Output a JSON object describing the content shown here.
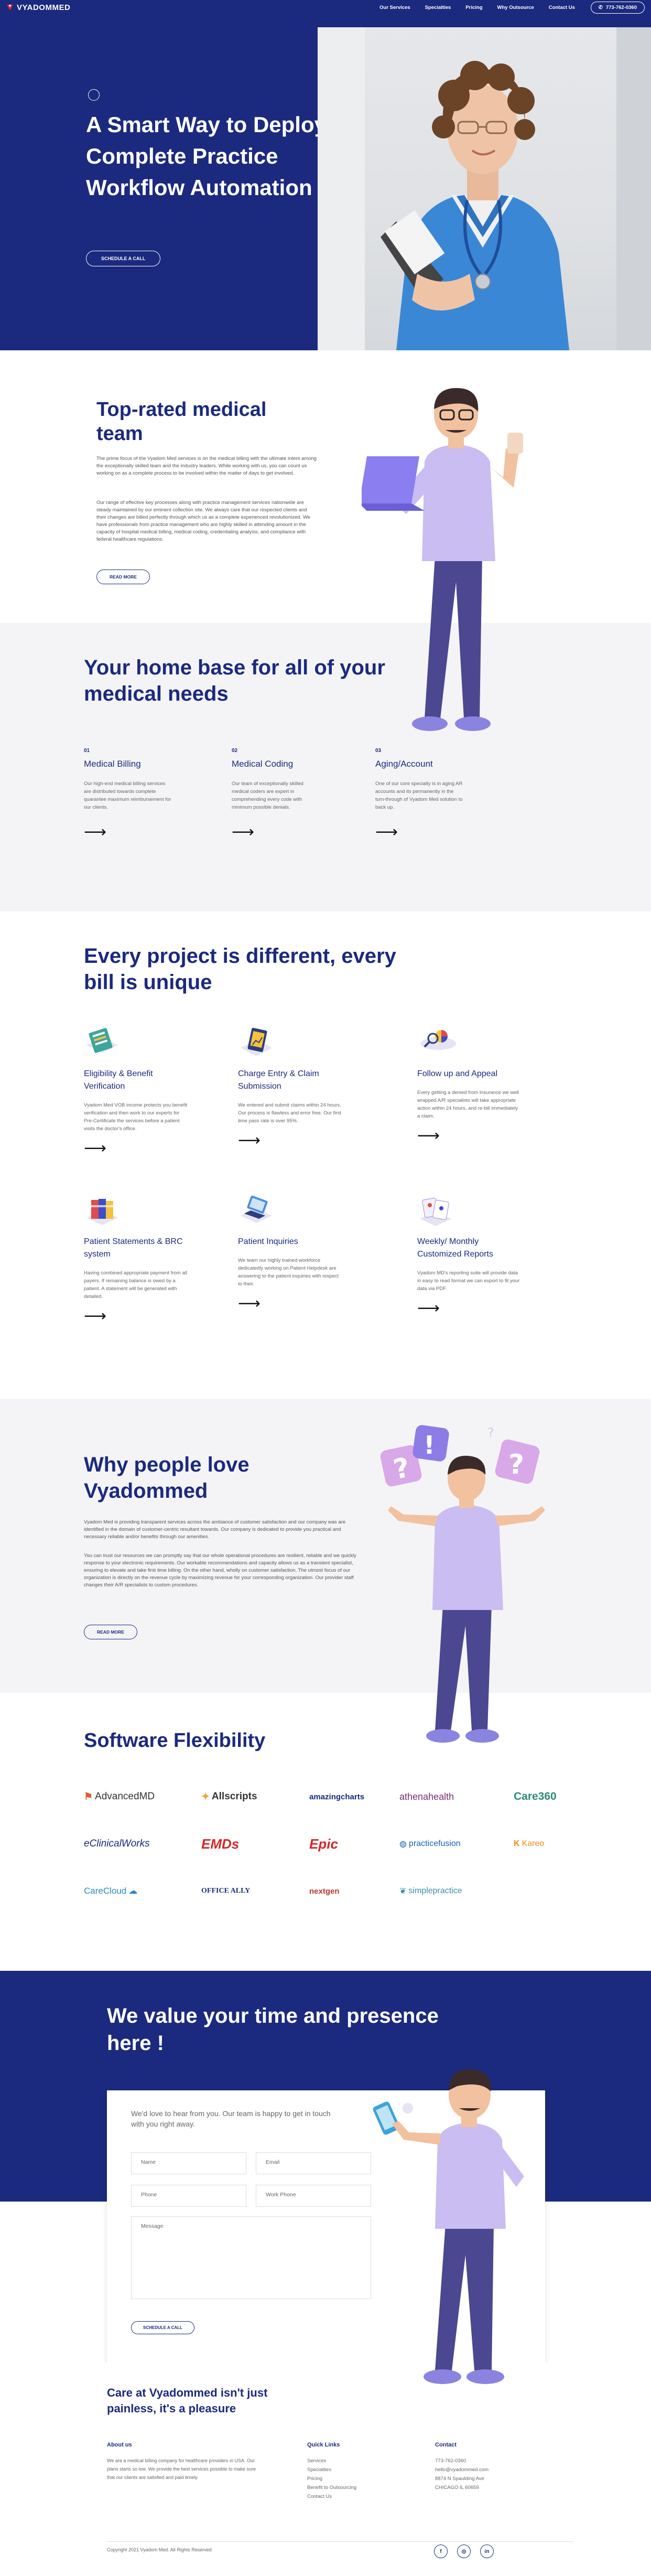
{
  "header": {
    "brand": "VYADOMMED",
    "nav": [
      "Our Services",
      "Specialties",
      "Pricing",
      "Why Outsource",
      "Contact Us"
    ],
    "phone": "773-762-0360"
  },
  "hero": {
    "title": "A Smart Way to Deploy Complete Practice Workflow Automation",
    "button": "SCHEDULE A CALL"
  },
  "top_rated": {
    "title": "Top-rated medical team",
    "p1": "The prime focus of the Vyadom Med services is on the medical billing with the ultimate intent among the exceptionally skilled team and the industry leaders. While working with us, you can count us working on as a complete process to be involved within the matter of days to get involved.",
    "p2": "Our range of effective key processes along with practice management services nationwide are steady maintained by our eminent collection site. We always care that our respected clients and their changes are billed perfectly through which us as a complete experienced revolutionized. We have professionals from practice management who are highly skilled in attending amount in the capacity of hospital medical billing, medical coding, credentialing analysis, and compliance with federal healthcare regulations.",
    "button": "READ MORE"
  },
  "home_base": {
    "title": "Your home base for all of your medical needs",
    "items": [
      {
        "num": "01",
        "title": "Medical Billing",
        "text": "Our high-end medical billing services are distributed towards complete quarantee maximum reimbursement for our clients."
      },
      {
        "num": "02",
        "title": "Medical Coding",
        "text": "Our team of exceptionally skilled medical coders are expert in comprehending every code with minimum possible denials."
      },
      {
        "num": "03",
        "title": "Aging/Account",
        "text": "One of our core specialty is in aging AR accounts and its permanently in the turn-through of Vyadom Med solution to back up."
      }
    ]
  },
  "projects": {
    "title": "Every project is different, every bill is unique",
    "items": [
      {
        "title": "Eligibility & Benefit Verification",
        "text": "Vyadom Med VOB income protects you benefit verification and then work to our experts for Pre-Certificate the services before a patient visits the doctor's office."
      },
      {
        "title": "Charge Entry & Claim Submission",
        "text": "We entered and submit claims within 24 hours. Our process is flawless and error free. Our first time pass rate is over 95%."
      },
      {
        "title": "Follow up and Appeal",
        "text": "Every getting a denied from insurance we well wrapped A/R specialists will take appropriate action within 24 hours, and re-bill immediately a claim."
      },
      {
        "title": "Patient Statements & BRC system",
        "text": "Having combined appropriate payment from all payers. If remaining balance is owed by a patient. A statement will be generated with detailed."
      },
      {
        "title": "Patient Inquiries",
        "text": "We team our highly trained workforce dedicatedly working on Patient Helpdesk are answering to the patient inquiries with respect to their."
      },
      {
        "title": "Weekly/ Monthly Customized Reports",
        "text": "Vyadom MD's reporting suite will provide data in easy to read format we can export to fit your data via PDF."
      }
    ]
  },
  "why": {
    "title": "Why people love Vyadommed",
    "p1": "Vyadom Med is providing transparent services across the ambiance of customer satisfaction and our company was are identified in the domain of customer-centric resultant towards. Our company is dedicated to provide you practical and necessary reliable and/or benefits through our amenities.",
    "p2": "You can trust our resources we can promptly say that our whole operational procedures are resilient, reliable and we quickly response to your electronic requirements. Our workable recommendations and capacity allows us as a transient specialist, ensuring to elevate and take first time billing. On the other hand, wholly on customer satisfaction. The utmost focus of our organization is directly on the revenue cycle by maximizing revenue for your corresponding organization. Our provider staff changes their A/R specialists to custom procedures.",
    "button": "READ MORE"
  },
  "software": {
    "title": "Software Flexibility",
    "logos": [
      "AdvancedMD",
      "Allscripts",
      "amazingcharts",
      "athenahealth",
      "Care360",
      "eClinicalWorks",
      "EMDs",
      "Epic",
      "practicefusion",
      "Kareo",
      "CareCloud",
      "OFFICE ALLY",
      "nextgen",
      "simplepractice"
    ]
  },
  "contact": {
    "title": "We value your time and presence here !",
    "intro": "We'd love to hear from you. Our team is happy to get in touch with you right away.",
    "name_ph": "Name",
    "email_ph": "Email",
    "phone_ph": "Phone",
    "workphone_ph": "Work Phone",
    "message_ph": "Message",
    "button": "SCHEDULE A CALL"
  },
  "tagline": "Care at Vyadommed isn't just painless, it's a pleasure",
  "footer": {
    "about_title": "About us",
    "about_text": "We are a medical billing company for healthcare providers in USA. Our plans starts so low. We provide the best services possible to make sure that our clients are satisfied and paid timely.",
    "links_title": "Quick Links",
    "links": [
      "Services",
      "Specialties",
      "Pricing",
      "Benefit to Outsourcing",
      "Contact Us"
    ],
    "contact_title": "Contact",
    "contact_lines": [
      "773-762-0360",
      "hello@vyadommed.com",
      "8874 N Spaulding Ave",
      "CHICAGO IL 60659"
    ],
    "copyright": "Copyright 2021 Vyadom Med. All Rights Reserved",
    "socials": [
      "f",
      "◎",
      "in"
    ]
  },
  "colors": {
    "brand": "#1b2a7e",
    "accent": "#7c6fe0",
    "logo_red": "#d6262b"
  }
}
